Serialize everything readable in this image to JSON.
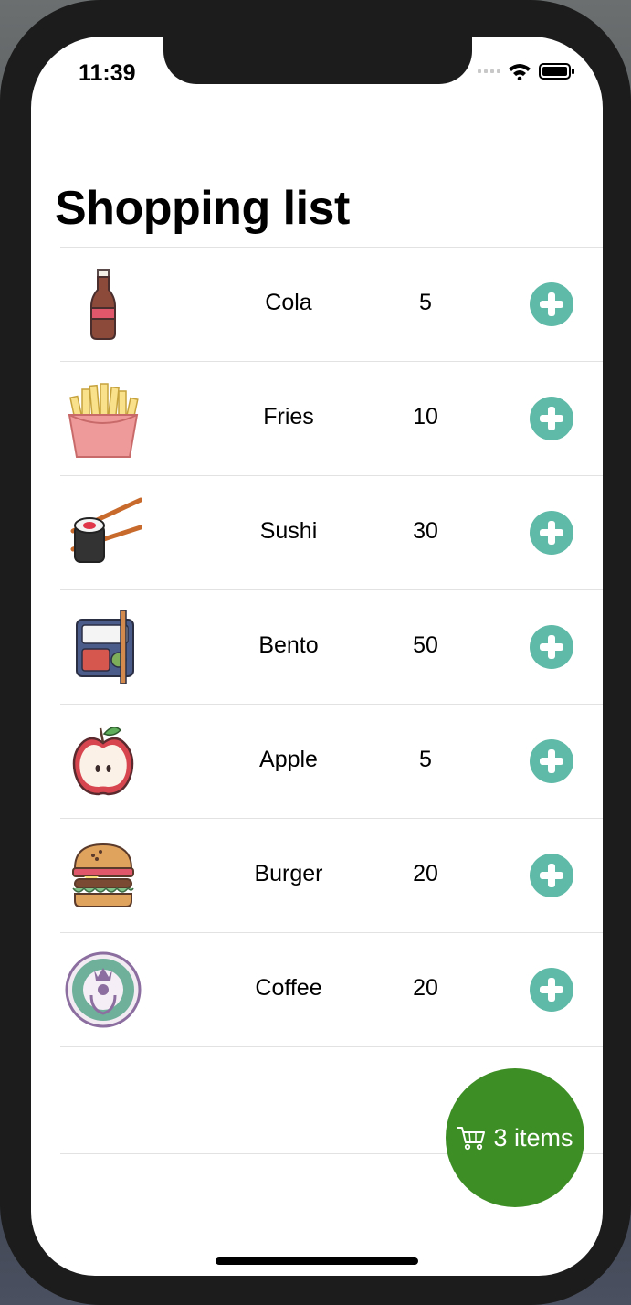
{
  "status_bar": {
    "time": "11:39"
  },
  "page": {
    "title": "Shopping list"
  },
  "items": [
    {
      "name": "Cola",
      "price": "5",
      "icon": "cola-bottle-icon"
    },
    {
      "name": "Fries",
      "price": "10",
      "icon": "fries-icon"
    },
    {
      "name": "Sushi",
      "price": "30",
      "icon": "sushi-icon"
    },
    {
      "name": "Bento",
      "price": "50",
      "icon": "bento-box-icon"
    },
    {
      "name": "Apple",
      "price": "5",
      "icon": "apple-icon"
    },
    {
      "name": "Burger",
      "price": "20",
      "icon": "burger-icon"
    },
    {
      "name": "Coffee",
      "price": "20",
      "icon": "coffee-logo-icon"
    }
  ],
  "cart": {
    "label": "3 items",
    "icon": "cart-icon"
  },
  "colors": {
    "add_button": "#5fbaa7",
    "cart_button": "#3e8e26"
  }
}
